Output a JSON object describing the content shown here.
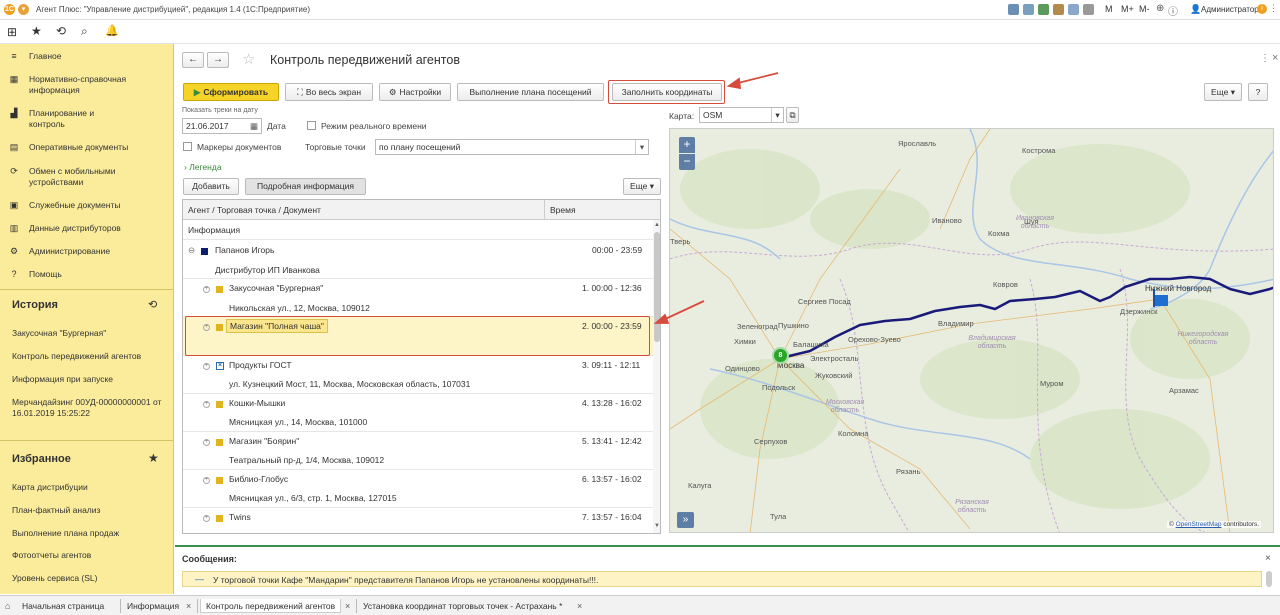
{
  "window": {
    "title": "Агент Плюс: \"Управление дистрибуцией\", редакция 1.4  (1С:Предприятие)",
    "user": "Администратор",
    "zoom_buttons": [
      "M",
      "M+",
      "M-"
    ]
  },
  "sidebar": {
    "items": [
      {
        "icon": "menu-icon",
        "label": "Главное"
      },
      {
        "icon": "reference-icon",
        "label": "Нормативно-справочная информация"
      },
      {
        "icon": "chart-icon",
        "label": "Планирование и контроль"
      },
      {
        "icon": "documents-icon",
        "label": "Оперативные документы"
      },
      {
        "icon": "sync-icon",
        "label": "Обмен с мобильными устройствами"
      },
      {
        "icon": "service-docs-icon",
        "label": "Служебные документы"
      },
      {
        "icon": "distributor-icon",
        "label": "Данные дистрибуторов"
      },
      {
        "icon": "gear-icon",
        "label": "Администрирование"
      },
      {
        "icon": "help-icon",
        "label": "Помощь"
      }
    ],
    "history_title": "История",
    "history": [
      "Закусочная \"Бургерная\"",
      "Контроль передвижений агентов",
      "Информация при запуске",
      "Мерчандайзинг 00УД-00000000001 от 16.01.2019 15:25:22"
    ],
    "favorites_title": "Избранное",
    "favorites": [
      "Карта дистрибуции",
      "План-фактный анализ",
      "Выполнение плана продаж",
      "Фотоотчеты агентов",
      "Уровень сервиса (SL)"
    ]
  },
  "form": {
    "title": "Контроль передвижений агентов",
    "buttons": {
      "generate": "Сформировать",
      "fullscreen": "Во весь экран",
      "settings": "Настройки",
      "visit_plan": "Выполнение плана посещений",
      "fill_coords": "Заполнить координаты",
      "more": "Еще",
      "help": "?"
    },
    "date_caption": "Показать треки на дату",
    "date_value": "21.06.2017",
    "date_label": "Дата",
    "realtime_label": "Режим реального времени",
    "doc_markers_label": "Маркеры документов",
    "trade_points_label": "Торговые точки",
    "trade_points_value": "по плану посещений",
    "legend_label": "Легенда",
    "add_button": "Добавить",
    "details_button": "Подробная информация",
    "table_more": "Еще",
    "map_label": "Карта:",
    "map_value": "OSM"
  },
  "table": {
    "columns": [
      "Агент / Торговая точка / Документ",
      "Время"
    ],
    "group": "Информация",
    "agent": {
      "name": "Папанов Игорь",
      "time": "00:00 - 23:59",
      "distributor": "Дистрибутор ИП Иванкова"
    },
    "rows": [
      {
        "name": "Закусочная \"Бургерная\"",
        "address": "Никольская ул., 12, Москва, 109012",
        "time": "1. 00:00 - 12:36",
        "marker": "yellow"
      },
      {
        "name": "Магазин \"Полная чаша\"",
        "address": "",
        "time": "2. 00:00 - 23:59",
        "marker": "yellow"
      },
      {
        "name": "Продукты ГОСТ",
        "address": "ул. Кузнецкий Мост, 11, Москва, Московская область, 107031",
        "time": "3. 09:11 - 12:11",
        "marker": "blue-x"
      },
      {
        "name": "Кошки-Мышки",
        "address": "Мясницкая ул., 14, Москва, 101000",
        "time": "4. 13:28 - 16:02",
        "marker": "yellow"
      },
      {
        "name": "Магазин \"Боярин\"",
        "address": "Театральный пр-д, 1/4, Москва, 109012",
        "time": "5. 13:41 - 12:42",
        "marker": "yellow"
      },
      {
        "name": "Библио-Глобус",
        "address": "Мясницкая ул., 6/3, стр. 1, Москва, 127015",
        "time": "6. 13:57 - 16:02",
        "marker": "yellow"
      },
      {
        "name": "Twins",
        "address": "",
        "time": "7. 13:57 - 16:04",
        "marker": "yellow"
      }
    ]
  },
  "map": {
    "zoom_in": "+",
    "zoom_out": "−",
    "cluster_count": "8",
    "attribution_prefix": "©",
    "attribution_link": "OpenStreetMap",
    "attribution_suffix": "contributors.",
    "cities": [
      "Ярославль",
      "Иваново",
      "Кострома",
      "Нижний Новгород",
      "Дзержинск",
      "Тверь",
      "Сергиев Посад",
      "Пушкино",
      "Зеленоград",
      "Москва",
      "Химки",
      "Балашиха",
      "Электросталь",
      "Орехово-Зуево",
      "Одинцово",
      "Жуковский",
      "Подольск",
      "Коломна",
      "Серпухов",
      "Рязань",
      "Владимир",
      "Ковров",
      "Муром",
      "Арзамас",
      "Калуга",
      "Тула",
      "Кохма",
      "Шуя"
    ],
    "regions": [
      "Ивановская область",
      "Владимирская область",
      "Московская область",
      "Нижегородская область",
      "Рязанская область"
    ],
    "route_color": "#1a1a7a",
    "cluster_color": "#2aa52a"
  },
  "messages": {
    "title": "Сообщения:",
    "text": "У торговой точки Кафе \"Мандарин\" представителя Папанов Игорь не установлены координаты!!!."
  },
  "tabs": [
    "Начальная страница",
    "Информация",
    "Контроль передвижений агентов",
    "Установка координат торговых точек - Астрахань *"
  ],
  "colors": {
    "sidebar_bg": "#fbec9b",
    "primary_button": "#f5d327",
    "annotation_red": "#d64b3c"
  }
}
